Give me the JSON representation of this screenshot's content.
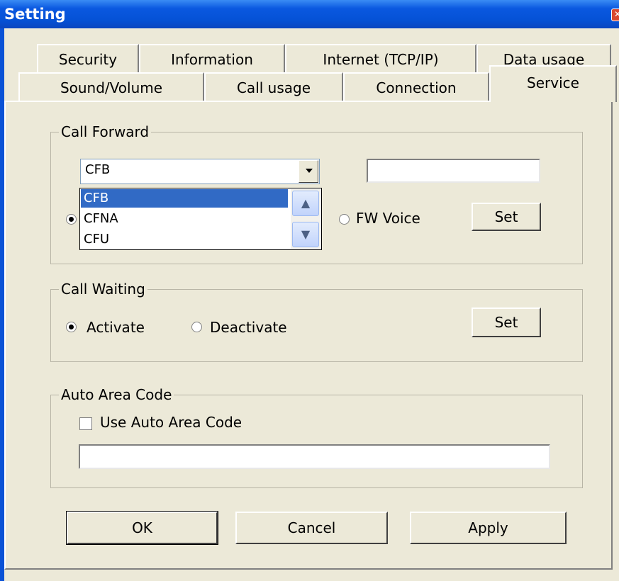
{
  "window": {
    "title": "Setting"
  },
  "tabs": {
    "row1": [
      "Security",
      "Information",
      "Internet (TCP/IP)",
      "Data usage"
    ],
    "row2": [
      "Sound/Volume",
      "Call usage",
      "Connection",
      "Service"
    ],
    "active": "Service"
  },
  "call_forward": {
    "title": "Call Forward",
    "combo_value": "CFB",
    "number_value": "",
    "dropdown_options": [
      "CFB",
      "CFNA",
      "CFU"
    ],
    "dropdown_selected": "CFB",
    "fw_voice_label": "FW Voice",
    "set_label": "Set"
  },
  "call_waiting": {
    "title": "Call Waiting",
    "activate_label": "Activate",
    "deactivate_label": "Deactivate",
    "selected": "Activate",
    "set_label": "Set"
  },
  "auto_area_code": {
    "title": "Auto Area Code",
    "checkbox_label": "Use Auto Area Code",
    "checked": false,
    "value": ""
  },
  "buttons": {
    "ok": "OK",
    "cancel": "Cancel",
    "apply": "Apply"
  }
}
